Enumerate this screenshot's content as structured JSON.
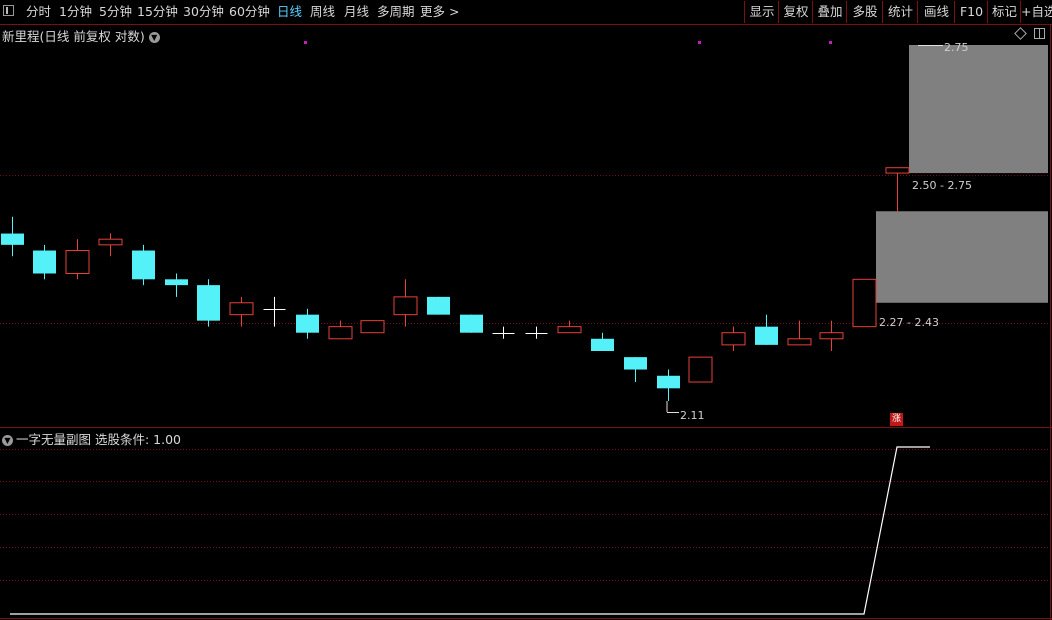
{
  "toolbar": {
    "periods": [
      {
        "label": "分时",
        "active": false
      },
      {
        "label": "1分钟",
        "active": false
      },
      {
        "label": "5分钟",
        "active": false
      },
      {
        "label": "15分钟",
        "active": false
      },
      {
        "label": "30分钟",
        "active": false
      },
      {
        "label": "60分钟",
        "active": false
      },
      {
        "label": "日线",
        "active": true
      },
      {
        "label": "周线",
        "active": false
      },
      {
        "label": "月线",
        "active": false
      },
      {
        "label": "多周期",
        "active": false
      },
      {
        "label": "更多 >",
        "active": false
      }
    ],
    "tools": [
      "显示",
      "复权",
      "叠加",
      "多股",
      "统计",
      "画线",
      "F10",
      "标记",
      "+自选"
    ]
  },
  "main_chart": {
    "title": "新里程(日线 前复权 对数)",
    "top_label": "2.75",
    "zones": [
      {
        "label": "2.50 - 2.75",
        "low": 2.5,
        "high": 2.75
      },
      {
        "label": "2.27 - 2.43",
        "low": 2.27,
        "high": 2.43
      }
    ],
    "low_label": "2.11",
    "zhang_badge": "涨"
  },
  "sub_chart": {
    "title": "一字无量副图  选股条件: 1.00"
  },
  "colors": {
    "up": "#e8403a",
    "down": "#54f2f8",
    "doji": "#ffffff",
    "zone": "#808080",
    "grid": "#7a1010",
    "marker": "#c020c0",
    "indicator_line": "#ffffff"
  },
  "chart_data": [
    {
      "type": "candlestick",
      "title": "新里程(日线 前复权 对数)",
      "y_scale": "log",
      "candles": [
        {
          "o": 2.39,
          "h": 2.42,
          "l": 2.35,
          "c": 2.37
        },
        {
          "o": 2.36,
          "h": 2.37,
          "l": 2.31,
          "c": 2.32
        },
        {
          "o": 2.32,
          "h": 2.38,
          "l": 2.31,
          "c": 2.36
        },
        {
          "o": 2.37,
          "h": 2.39,
          "l": 2.35,
          "c": 2.38
        },
        {
          "o": 2.36,
          "h": 2.37,
          "l": 2.3,
          "c": 2.31
        },
        {
          "o": 2.31,
          "h": 2.32,
          "l": 2.28,
          "c": 2.3
        },
        {
          "o": 2.3,
          "h": 2.31,
          "l": 2.23,
          "c": 2.24
        },
        {
          "o": 2.25,
          "h": 2.28,
          "l": 2.23,
          "c": 2.27
        },
        {
          "o": 2.26,
          "h": 2.28,
          "l": 2.23,
          "c": 2.26
        },
        {
          "o": 2.25,
          "h": 2.26,
          "l": 2.21,
          "c": 2.22
        },
        {
          "o": 2.21,
          "h": 2.24,
          "l": 2.21,
          "c": 2.23
        },
        {
          "o": 2.22,
          "h": 2.24,
          "l": 2.22,
          "c": 2.24
        },
        {
          "o": 2.25,
          "h": 2.31,
          "l": 2.23,
          "c": 2.28
        },
        {
          "o": 2.28,
          "h": 2.28,
          "l": 2.25,
          "c": 2.25
        },
        {
          "o": 2.25,
          "h": 2.25,
          "l": 2.22,
          "c": 2.22
        },
        {
          "o": 2.22,
          "h": 2.23,
          "l": 2.21,
          "c": 2.22
        },
        {
          "o": 2.22,
          "h": 2.23,
          "l": 2.21,
          "c": 2.22
        },
        {
          "o": 2.22,
          "h": 2.24,
          "l": 2.22,
          "c": 2.23
        },
        {
          "o": 2.21,
          "h": 2.22,
          "l": 2.19,
          "c": 2.19
        },
        {
          "o": 2.18,
          "h": 2.18,
          "l": 2.14,
          "c": 2.16
        },
        {
          "o": 2.15,
          "h": 2.16,
          "l": 2.11,
          "c": 2.13
        },
        {
          "o": 2.14,
          "h": 2.18,
          "l": 2.14,
          "c": 2.18
        },
        {
          "o": 2.2,
          "h": 2.23,
          "l": 2.19,
          "c": 2.22
        },
        {
          "o": 2.23,
          "h": 2.25,
          "l": 2.2,
          "c": 2.2
        },
        {
          "o": 2.2,
          "h": 2.24,
          "l": 2.2,
          "c": 2.21
        },
        {
          "o": 2.21,
          "h": 2.24,
          "l": 2.19,
          "c": 2.22
        },
        {
          "o": 2.23,
          "h": 2.31,
          "l": 2.23,
          "c": 2.31
        },
        {
          "o": 2.5,
          "h": 2.51,
          "l": 2.43,
          "c": 2.51
        }
      ]
    },
    {
      "type": "line",
      "title": "一字无量副图",
      "series": [
        {
          "values": [
            0,
            0,
            0,
            0,
            0,
            0,
            0,
            0,
            0,
            0,
            0,
            0,
            0,
            0,
            0,
            0,
            0,
            0,
            0,
            0,
            0,
            0,
            0,
            0,
            0,
            0,
            0,
            1,
            1
          ]
        }
      ]
    }
  ]
}
